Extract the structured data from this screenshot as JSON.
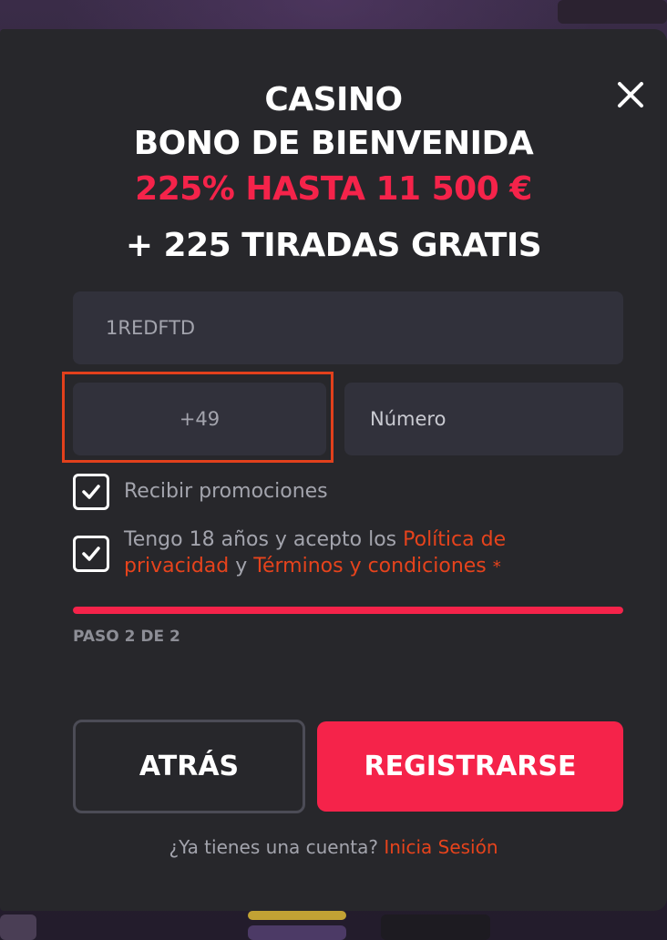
{
  "modal": {
    "title_line1": "CASINO",
    "title_line2": "BONO DE BIENVENIDA",
    "bonus_line": "225% HASTA 11 500 €",
    "spins_line": "+ 225 TIRADAS GRATIS"
  },
  "form": {
    "promo_code_value": "1REDFTD",
    "country_code_value": "+49",
    "phone_placeholder": "Número"
  },
  "checkboxes": {
    "promotions": {
      "checked": true,
      "label": "Recibir promociones"
    },
    "terms": {
      "checked": true,
      "label_prefix": "Tengo 18 años y acepto los",
      "privacy_link": "Política de privacidad",
      "connector": "y",
      "terms_link": "Términos y condiciones",
      "required_mark": "*"
    }
  },
  "progress": {
    "step_label": "PASO 2 DE 2",
    "fraction": 1.0
  },
  "buttons": {
    "back_label": "ATRÁS",
    "register_label": "REGISTRARSE"
  },
  "footer": {
    "question": "¿Ya tienes una cuenta?",
    "login_link": "Inicia Sesión"
  },
  "colors": {
    "accent_red": "#f5234a",
    "link_orange": "#e6431c",
    "modal_bg": "#27272b",
    "field_bg": "#31313b"
  },
  "icons": {
    "close": "close-icon",
    "check": "checkmark-icon"
  }
}
